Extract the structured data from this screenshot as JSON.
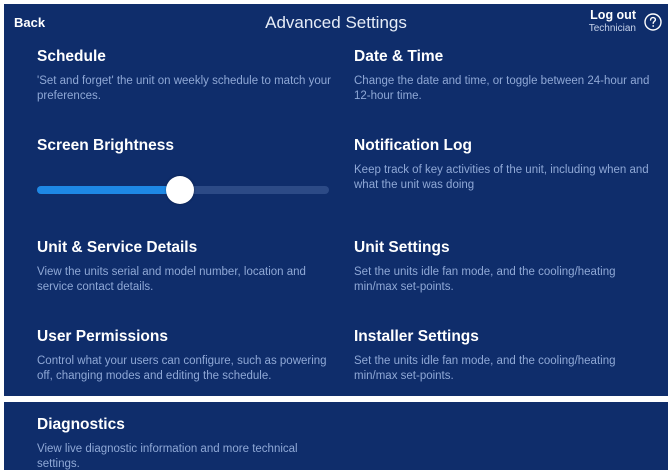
{
  "header": {
    "back_label": "Back",
    "title": "Advanced Settings",
    "logout_label": "Log out",
    "user_role": "Technician",
    "help_icon": "question-circle-icon"
  },
  "settings": {
    "schedule": {
      "title": "Schedule",
      "description": "'Set and forget' the unit on weekly schedule to match your preferences."
    },
    "date_time": {
      "title": "Date & Time",
      "description": "Change the date and time, or toggle between 24-hour and 12-hour time."
    },
    "screen_brightness": {
      "title": "Screen Brightness",
      "level_percent": 49
    },
    "notification_log": {
      "title": "Notification Log",
      "description": "Keep track of key activities of the unit, including when and what the unit was doing"
    },
    "unit_service_details": {
      "title": "Unit & Service Details",
      "description": "View the units serial and model number, location and service contact details."
    },
    "unit_settings": {
      "title": "Unit Settings",
      "description": "Set the units idle fan mode, and the cooling/heating min/max set-points."
    },
    "user_permissions": {
      "title": "User Permissions",
      "description": "Control what your users can configure, such as powering off, changing modes and editing the schedule."
    },
    "installer_settings": {
      "title": "Installer Settings",
      "description": "Set the units idle fan mode, and the cooling/heating min/max set-points."
    },
    "diagnostics": {
      "title": "Diagnostics",
      "description": "View live diagnostic information and more technical settings."
    }
  },
  "colors": {
    "background": "#0f2d6b",
    "accent": "#1e88e5",
    "description_text": "#8fa8d6"
  }
}
